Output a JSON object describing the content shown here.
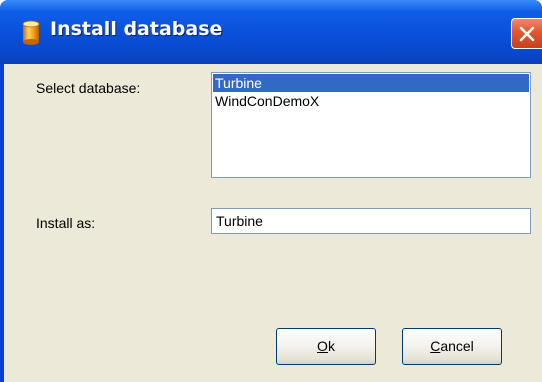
{
  "window": {
    "title": "Install database",
    "title_icon": "database-icon",
    "close_icon": "close-icon"
  },
  "form": {
    "select_label": "Select database:",
    "databases": [
      {
        "name": "Turbine",
        "selected": true
      },
      {
        "name": "WindConDemoX",
        "selected": false
      }
    ],
    "install_as_label": "Install as:",
    "install_as_value": "Turbine"
  },
  "buttons": {
    "ok": {
      "accel": "O",
      "rest": "k"
    },
    "cancel": {
      "accel": "C",
      "rest": "ancel"
    }
  },
  "colors": {
    "titlebar": "#0a4fd9",
    "dialog_bg": "#ece9d8",
    "selection": "#316ac5",
    "close_button": "#e0562e"
  }
}
